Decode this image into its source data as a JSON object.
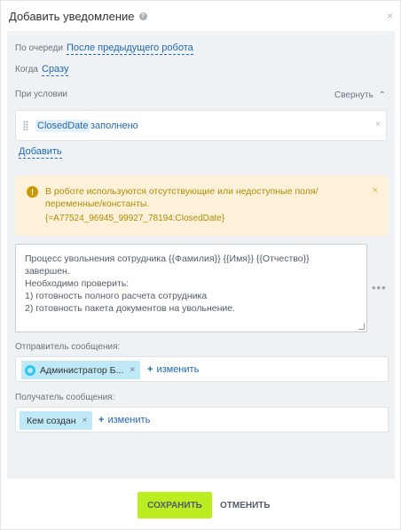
{
  "header": {
    "title": "Добавить уведомление",
    "help_icon": "?",
    "close_icon": "×"
  },
  "queue": {
    "label": "По очереди",
    "value": "После предыдущего робота"
  },
  "when": {
    "label": "Когда",
    "value": "Сразу"
  },
  "condition": {
    "label": "При условии",
    "collapse_label": "Свернуть",
    "collapse_icon": "⌃",
    "field": "ClosedDate",
    "operator": "заполнено",
    "remove_icon": "×",
    "add_label": "Добавить"
  },
  "warning": {
    "icon": "!",
    "text": "В роботе используются отсутствующие или недоступные поля/переменные/константы.",
    "code": "{=A77524_96945_99927_78194:ClosedDate}",
    "close_icon": "×"
  },
  "message": {
    "text": "Процесс увольнения сотрудника {{Фамилия}} {{Имя}} {{Отчество}}  завершен.\nНеобходимо проверить:\n1) готовность полного расчета сотрудника\n2) готовность пакета документов на увольнение.",
    "more_icon": "•••"
  },
  "sender": {
    "label": "Отправитель сообщения:",
    "chip": "Администратор Б...",
    "chip_remove": "×",
    "change_plus": "+",
    "change_label": "изменить"
  },
  "recipient": {
    "label": "Получатель сообщения:",
    "chip": "Кем создан",
    "chip_remove": "×",
    "change_plus": "+",
    "change_label": "изменить"
  },
  "footer": {
    "save_label": "Сохранить",
    "cancel_label": "Отменить"
  },
  "colors": {
    "save_button": "#bbed21",
    "link": "#2067b0",
    "warning_bg": "#fdf2d9",
    "chip_bg": "#bfe9f6"
  }
}
